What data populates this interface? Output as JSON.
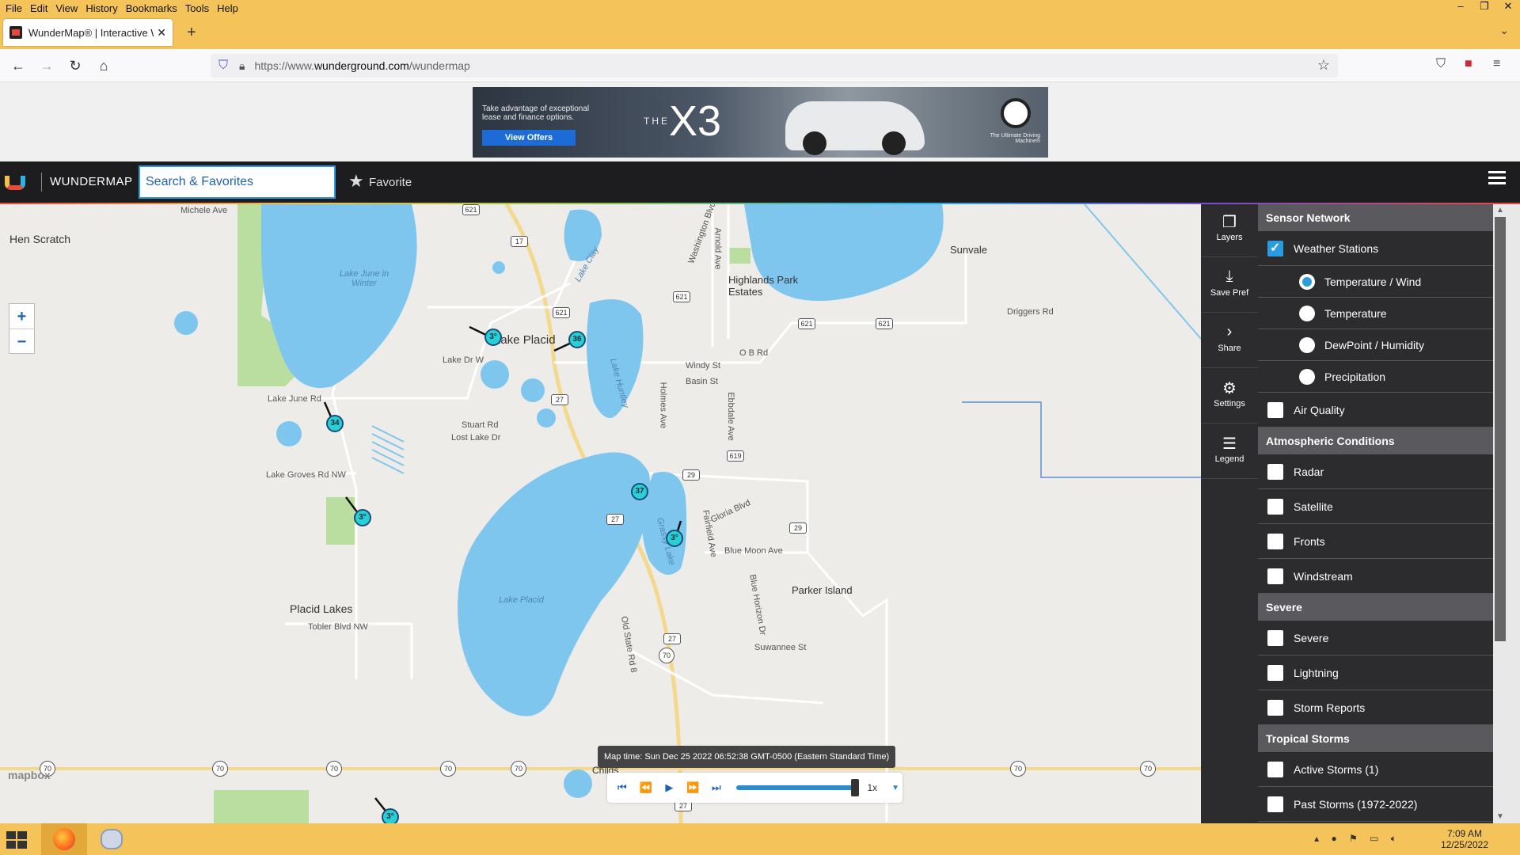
{
  "browser": {
    "menu": [
      "File",
      "Edit",
      "View",
      "History",
      "Bookmarks",
      "Tools",
      "Help"
    ],
    "tab_title": "WunderMap® | Interactive We",
    "url_prefix": "https://www.",
    "url_host": "wunderground.com",
    "url_path": "/wundermap",
    "window_controls": [
      "–",
      "❐",
      "✕"
    ]
  },
  "ad": {
    "promo": "Take advantage of exceptional lease and finance options.",
    "button": "View Offers",
    "the": "THE",
    "model": "X3",
    "tagline": "The Ultimate Driving Machine®"
  },
  "header": {
    "brand": "WUNDERMAP",
    "search_placeholder": "Search & Favorites",
    "favorite_label": "Favorite"
  },
  "map": {
    "labels": {
      "hen_scratch": "Hen Scratch",
      "michele_ave": "Michele Ave",
      "lake_june": "Lake June in Winter",
      "lake_placid_town": "Lake Placid",
      "lake_dr_w": "Lake Dr W",
      "lake_june_rd": "Lake June Rd",
      "stuart_rd": "Stuart Rd",
      "lost_lake_dr": "Lost Lake Dr",
      "lake_groves": "Lake Groves Rd NW",
      "placid_lakes": "Placid Lakes",
      "tobler": "Tobler Blvd NW",
      "lake_placid_water": "Lake Placid",
      "lake_clay": "Lake Clay",
      "lake_huntley": "Lake Huntley",
      "grassy_lake": "Grassy Lake",
      "highlands_park": "Highlands Park Estates",
      "sunvale": "Sunvale",
      "driggers": "Driggers Rd",
      "ob_rd": "O B Rd",
      "windy_st": "Windy St",
      "basin_st": "Basin St",
      "holmes_ave": "Holmes Ave",
      "ebbdale": "Ebbdale Ave",
      "gloria": "Gloria Blvd",
      "fairfield": "Fairfield Ave",
      "blue_moon": "Blue Moon Ave",
      "blue_horizon": "Blue Horizon Dr",
      "parker_island": "Parker Island",
      "suwannee": "Suwannee St",
      "old_state": "Old State Rd 8",
      "childs": "Childs",
      "washington_blvd": "Washington Blvd",
      "arnold_ave": "Arnold Ave",
      "placid_lakes_blvd": "Placid Lakes"
    },
    "stations": [
      "3°",
      "36",
      "34",
      "3°",
      "37",
      "3°",
      "3°"
    ],
    "route_shields": [
      "621",
      "17",
      "621",
      "621",
      "621",
      "621",
      "27",
      "619",
      "29",
      "27",
      "29",
      "27",
      "27",
      "70",
      "70",
      "70",
      "70",
      "70",
      "70",
      "70",
      "70"
    ],
    "zoom_in": "+",
    "zoom_out": "−",
    "attribution": "mapbox",
    "map_time": "Map time: Sun Dec 25 2022 06:52:38 GMT-0500 (Eastern Standard Time)",
    "player": {
      "speed": "1x",
      "progress": 1.0
    }
  },
  "toolbar": [
    {
      "icon": "layers-icon",
      "label": "Layers"
    },
    {
      "icon": "save-icon",
      "label": "Save Pref"
    },
    {
      "icon": "share-icon",
      "label": "Share"
    },
    {
      "icon": "gear-icon",
      "label": "Settings"
    },
    {
      "icon": "legend-icon",
      "label": "Legend"
    }
  ],
  "panel": {
    "sensor_network": "Sensor Network",
    "weather_stations": "Weather Stations",
    "temp_wind": "Temperature / Wind",
    "temperature": "Temperature",
    "dewpoint": "DewPoint / Humidity",
    "precipitation": "Precipitation",
    "air_quality": "Air Quality",
    "atmospheric": "Atmospheric Conditions",
    "radar": "Radar",
    "satellite": "Satellite",
    "fronts": "Fronts",
    "windstream": "Windstream",
    "severe_section": "Severe",
    "severe": "Severe",
    "lightning": "Lightning",
    "storm_reports": "Storm Reports",
    "tropical": "Tropical Storms",
    "active_storms": "Active Storms (1)",
    "past_storms": "Past Storms (1972-2022)"
  },
  "taskbar": {
    "time": "7:09 AM",
    "date": "12/25/2022"
  },
  "colors": {
    "chrome": "#f4c45a",
    "water": "#7fc6ee",
    "station": "#27d0d4",
    "accent": "#2a9de1"
  }
}
